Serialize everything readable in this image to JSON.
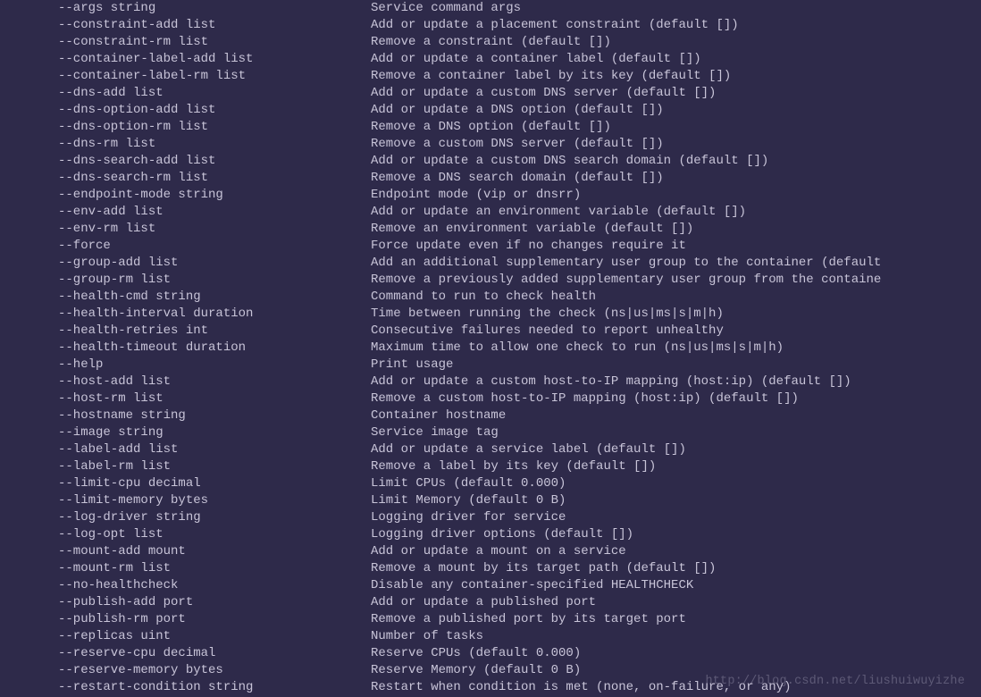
{
  "options": [
    {
      "flag": "--args string",
      "desc": "Service command args"
    },
    {
      "flag": "--constraint-add list",
      "desc": "Add or update a placement constraint (default [])"
    },
    {
      "flag": "--constraint-rm list",
      "desc": "Remove a constraint (default [])"
    },
    {
      "flag": "--container-label-add list",
      "desc": "Add or update a container label (default [])"
    },
    {
      "flag": "--container-label-rm list",
      "desc": "Remove a container label by its key (default [])"
    },
    {
      "flag": "--dns-add list",
      "desc": "Add or update a custom DNS server (default [])"
    },
    {
      "flag": "--dns-option-add list",
      "desc": "Add or update a DNS option (default [])"
    },
    {
      "flag": "--dns-option-rm list",
      "desc": "Remove a DNS option (default [])"
    },
    {
      "flag": "--dns-rm list",
      "desc": "Remove a custom DNS server (default [])"
    },
    {
      "flag": "--dns-search-add list",
      "desc": "Add or update a custom DNS search domain (default [])"
    },
    {
      "flag": "--dns-search-rm list",
      "desc": "Remove a DNS search domain (default [])"
    },
    {
      "flag": "--endpoint-mode string",
      "desc": "Endpoint mode (vip or dnsrr)"
    },
    {
      "flag": "--env-add list",
      "desc": "Add or update an environment variable (default [])"
    },
    {
      "flag": "--env-rm list",
      "desc": "Remove an environment variable (default [])"
    },
    {
      "flag": "--force",
      "desc": "Force update even if no changes require it"
    },
    {
      "flag": "--group-add list",
      "desc": "Add an additional supplementary user group to the container (default"
    },
    {
      "flag": "--group-rm list",
      "desc": "Remove a previously added supplementary user group from the containe"
    },
    {
      "flag": "--health-cmd string",
      "desc": "Command to run to check health"
    },
    {
      "flag": "--health-interval duration",
      "desc": "Time between running the check (ns|us|ms|s|m|h)"
    },
    {
      "flag": "--health-retries int",
      "desc": "Consecutive failures needed to report unhealthy"
    },
    {
      "flag": "--health-timeout duration",
      "desc": "Maximum time to allow one check to run (ns|us|ms|s|m|h)"
    },
    {
      "flag": "--help",
      "desc": "Print usage"
    },
    {
      "flag": "--host-add list",
      "desc": "Add or update a custom host-to-IP mapping (host:ip) (default [])"
    },
    {
      "flag": "--host-rm list",
      "desc": "Remove a custom host-to-IP mapping (host:ip) (default [])"
    },
    {
      "flag": "--hostname string",
      "desc": "Container hostname"
    },
    {
      "flag": "--image string",
      "desc": "Service image tag"
    },
    {
      "flag": "--label-add list",
      "desc": "Add or update a service label (default [])"
    },
    {
      "flag": "--label-rm list",
      "desc": "Remove a label by its key (default [])"
    },
    {
      "flag": "--limit-cpu decimal",
      "desc": "Limit CPUs (default 0.000)"
    },
    {
      "flag": "--limit-memory bytes",
      "desc": "Limit Memory (default 0 B)"
    },
    {
      "flag": "--log-driver string",
      "desc": "Logging driver for service"
    },
    {
      "flag": "--log-opt list",
      "desc": "Logging driver options (default [])"
    },
    {
      "flag": "--mount-add mount",
      "desc": "Add or update a mount on a service"
    },
    {
      "flag": "--mount-rm list",
      "desc": "Remove a mount by its target path (default [])"
    },
    {
      "flag": "--no-healthcheck",
      "desc": "Disable any container-specified HEALTHCHECK"
    },
    {
      "flag": "--publish-add port",
      "desc": "Add or update a published port"
    },
    {
      "flag": "--publish-rm port",
      "desc": "Remove a published port by its target port"
    },
    {
      "flag": "--replicas uint",
      "desc": "Number of tasks"
    },
    {
      "flag": "--reserve-cpu decimal",
      "desc": "Reserve CPUs (default 0.000)"
    },
    {
      "flag": "--reserve-memory bytes",
      "desc": "Reserve Memory (default 0 B)"
    },
    {
      "flag": "--restart-condition string",
      "desc": "Restart when condition is met (none, on-failure, or any)"
    }
  ],
  "watermark": "http://blog.csdn.net/liushuiwuyizhe"
}
